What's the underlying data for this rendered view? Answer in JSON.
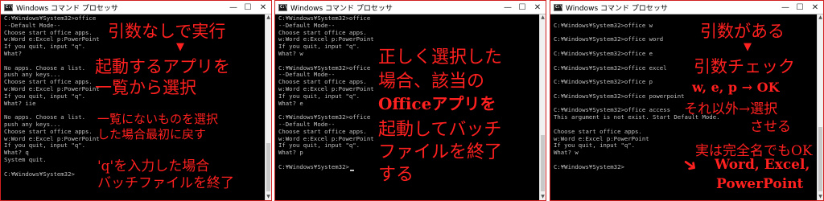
{
  "window_title": "Windows コマンド プロセッサ",
  "app_icon_text": "C:\\",
  "controls": {
    "minimize": "—",
    "maximize": "☐",
    "close": "✕"
  },
  "panel1": {
    "lines": [
      "C:¥Windows¥System32>office",
      "--Default Mode--",
      "Choose start office apps.",
      "w:Word e:Excel p:PowerPoint",
      "If you quit, input \"q\".",
      "What?",
      "",
      "No apps. Choose a list.",
      "push any keys...",
      "Choose start office apps.",
      "w:Word e:Excel p:PowerPoint",
      "If you quit, input \"q\".",
      "What? iie",
      "",
      "No apps. Choose a list.",
      "push any keys...",
      "Choose start office apps.",
      "w:Word e:Excel p:PowerPoint",
      "If you quit, input \"q\".",
      "What? q",
      "System quit.",
      "",
      "C:¥Windows¥System32>"
    ],
    "notes": [
      "引数なしで実行",
      "▼",
      "起動するアプリを",
      "一覧から選択",
      "一覧にないものを選択",
      "した場合最初に戻す",
      "'q'を入力した場合",
      "バッチファイルを終了"
    ]
  },
  "panel2": {
    "lines": [
      "C:¥Windows¥System32>office",
      "--Default Mode--",
      "Choose start office apps.",
      "w:Word e:Excel p:PowerPoint",
      "If you quit, input \"q\".",
      "What? w",
      "",
      "C:¥Windows¥System32>office",
      "--Default Mode--",
      "Choose start office apps.",
      "w:Word e:Excel p:PowerPoint",
      "If you quit, input \"q\".",
      "What? e",
      "",
      "C:¥Windows¥System32>office",
      "--Default Mode--",
      "Choose start office apps.",
      "w:Word e:Excel p:PowerPoint",
      "If you quit, input \"q\".",
      "What? p",
      "",
      "C:¥Windows¥System32>"
    ],
    "notes": [
      "正しく選択した",
      "場合、該当の",
      "Officeアプリを",
      "起動してバッチ",
      "ファイルを終了",
      "する"
    ]
  },
  "panel3": {
    "lines": [
      "",
      "C:¥Windows¥System32>office w",
      "",
      "C:¥Windows¥System32>office word",
      "",
      "C:¥Windows¥System32>office e",
      "",
      "C:¥Windows¥System32>office excel",
      "",
      "C:¥Windows¥System32>office p",
      "",
      "C:¥Windows¥System32>office powerpoint",
      "",
      "C:¥Windows¥System32>office access",
      "This argument is not exist. Start Default Mode.",
      "",
      "Choose start office apps.",
      "w:Word e:Excel p:PowerPoint",
      "If you quit, input \"q\".",
      "What? w",
      "",
      "C:¥Windows¥System32>"
    ],
    "notes": [
      "引数がある",
      "▼",
      "引数チェック",
      "w, e, p → OK",
      "それ以外→選択",
      "させる",
      "実は完全名でもOK",
      "Word, Excel,",
      "PowerPoint"
    ],
    "arrow": "➜"
  }
}
